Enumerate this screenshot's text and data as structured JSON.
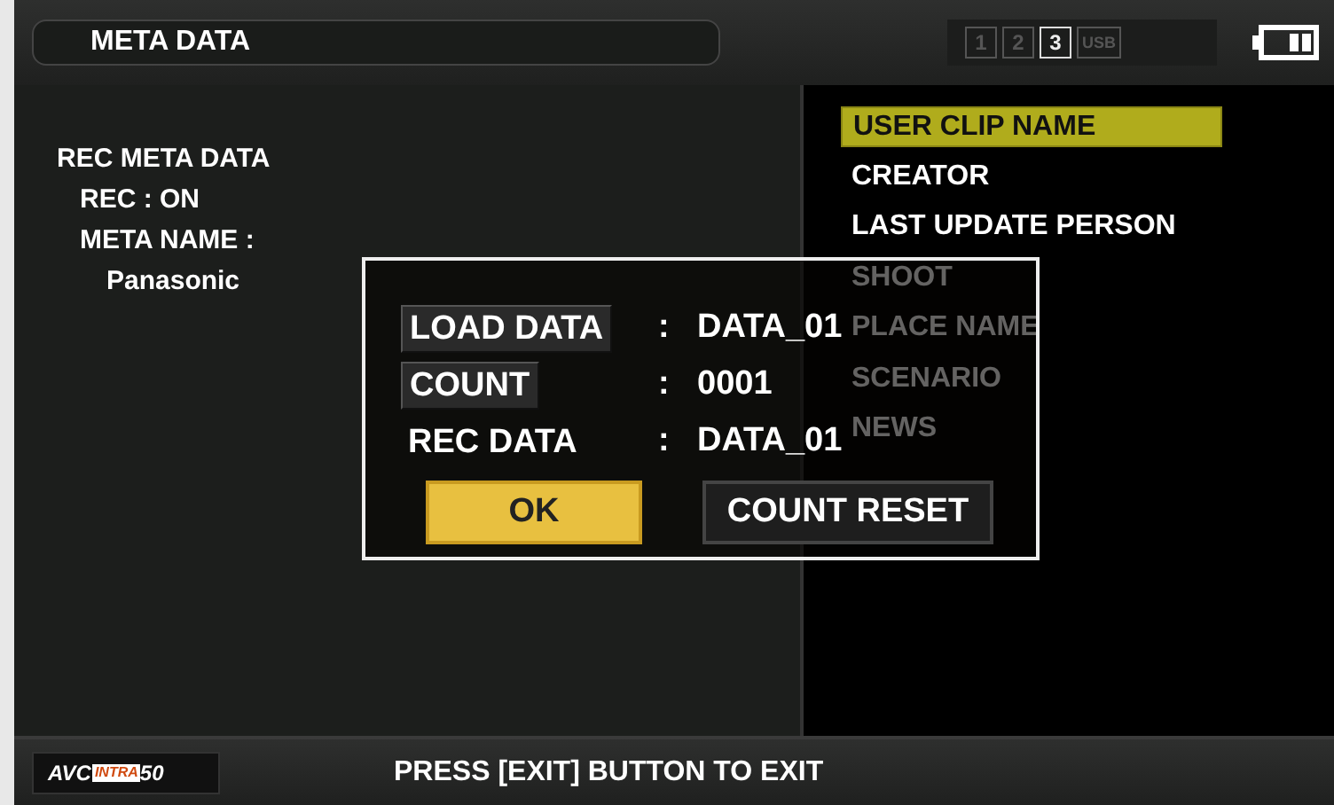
{
  "header": {
    "title": "META DATA",
    "media_slots": [
      {
        "label": "1",
        "selected": false
      },
      {
        "label": "2",
        "selected": false
      },
      {
        "label": "3",
        "selected": true
      },
      {
        "label": "USB",
        "selected": false
      }
    ]
  },
  "rec_meta": {
    "heading": "REC META DATA",
    "lines": [
      "REC : ON",
      "META NAME :"
    ],
    "value": "Panasonic"
  },
  "menu": [
    {
      "label": "USER CLIP NAME",
      "selected": true
    },
    {
      "label": "CREATOR",
      "selected": false
    },
    {
      "label": "LAST UPDATE PERSON",
      "selected": false
    },
    {
      "label": "SHOOT",
      "selected": false
    },
    {
      "label": "PLACE NAME",
      "selected": false
    },
    {
      "label": "SCENARIO",
      "selected": false
    },
    {
      "label": "NEWS",
      "selected": false
    }
  ],
  "dialog": {
    "rows": [
      {
        "kind": "button",
        "label": "LOAD DATA",
        "separator": ":",
        "value": "DATA_01"
      },
      {
        "kind": "button",
        "label": "COUNT",
        "separator": ":",
        "value": "0001"
      },
      {
        "kind": "text",
        "label": "REC DATA",
        "separator": ":",
        "value": "DATA_01"
      }
    ],
    "buttons": [
      {
        "label": "OK",
        "selected": true
      },
      {
        "label": "COUNT RESET",
        "selected": false
      }
    ]
  },
  "footer": {
    "logo": [
      "AVC",
      "INTRA",
      "50"
    ],
    "message": "PRESS [EXIT] BUTTON TO EXIT"
  }
}
